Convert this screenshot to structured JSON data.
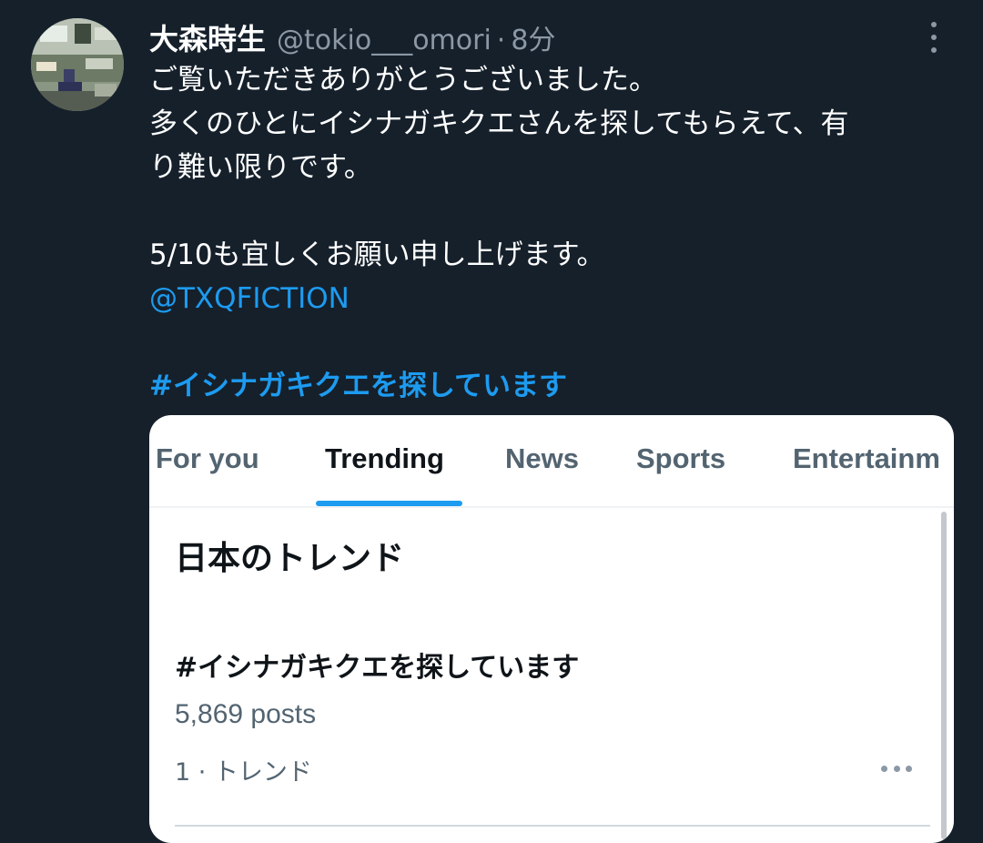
{
  "tweet": {
    "author_name": "大森時生",
    "author_handle": "@tokio___omori",
    "separator": "·",
    "time": "8分",
    "lines": [
      "ご覧いただきありがとうございました。",
      "多くのひとにイシナガキクエさんを探してもらえて、有",
      "り難い限りです。"
    ],
    "line2": "5/10も宜しくお願い申し上げます。",
    "mention": "@TXQFICTION",
    "hashtag": "#イシナガキクエを探しています"
  },
  "embed": {
    "tabs": [
      {
        "label": "For you"
      },
      {
        "label": "Trending"
      },
      {
        "label": "News"
      },
      {
        "label": "Sports"
      },
      {
        "label": "Entertainm"
      }
    ],
    "active_tab": "Trending",
    "section_title": "日本のトレンド",
    "trend": {
      "name": "#イシナガキクエを探しています",
      "count": "5,869 posts",
      "meta": "1 · トレンド"
    }
  },
  "icons": {
    "more": "more-vertical-icon",
    "trend_more": "more-horizontal-icon"
  },
  "colors": {
    "background": "#15202b",
    "link": "#1d9bf0",
    "secondary_text": "#8b98a5"
  }
}
